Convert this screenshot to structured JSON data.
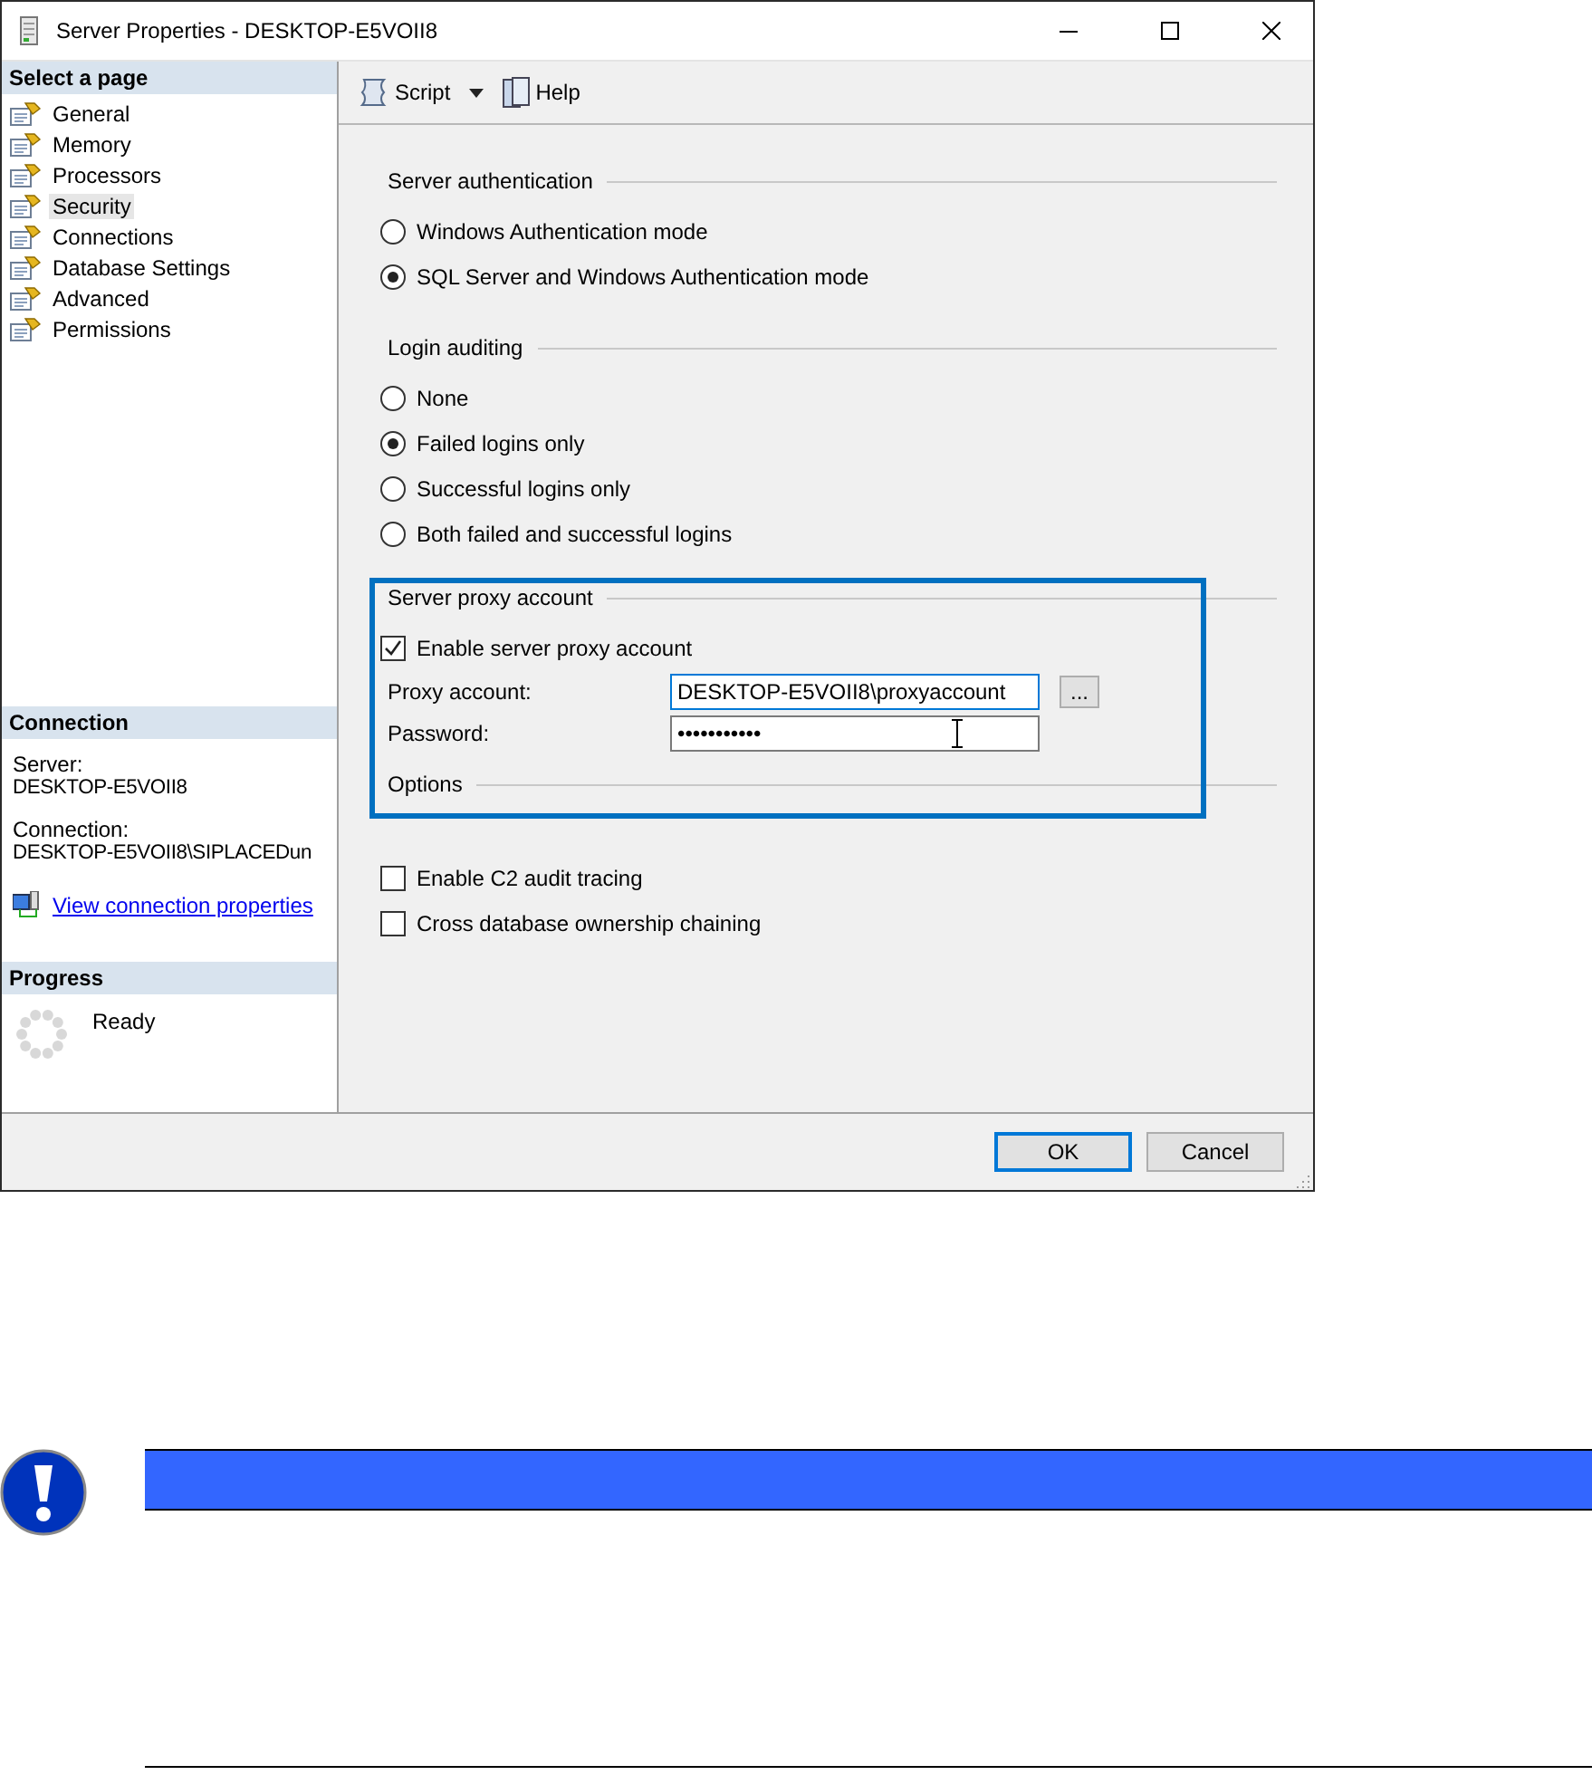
{
  "window": {
    "title": "Server Properties - DESKTOP-E5VOII8"
  },
  "sidebar": {
    "select_page": {
      "title": "Select a page",
      "pages": [
        {
          "label": "General",
          "selected": false
        },
        {
          "label": "Memory",
          "selected": false
        },
        {
          "label": "Processors",
          "selected": false
        },
        {
          "label": "Security",
          "selected": true
        },
        {
          "label": "Connections",
          "selected": false
        },
        {
          "label": "Database Settings",
          "selected": false
        },
        {
          "label": "Advanced",
          "selected": false
        },
        {
          "label": "Permissions",
          "selected": false
        }
      ]
    },
    "connection": {
      "title": "Connection",
      "fields": [
        {
          "label": "Server:",
          "value": "DESKTOP-E5VOII8"
        },
        {
          "label": "Connection:",
          "value": "DESKTOP-E5VOII8\\SIPLACEDun"
        }
      ],
      "link": "View connection properties"
    },
    "progress": {
      "title": "Progress",
      "status": "Ready"
    }
  },
  "toolbar": {
    "script": "Script",
    "help": "Help"
  },
  "sections": [
    {
      "title": "Server authentication",
      "items": [
        {
          "kind": "radio",
          "label": "Windows Authentication mode",
          "selected": false
        },
        {
          "kind": "radio",
          "label": "SQL Server and Windows Authentication mode",
          "selected": true
        }
      ]
    },
    {
      "title": "Login auditing",
      "items": [
        {
          "kind": "radio",
          "label": "None",
          "selected": false
        },
        {
          "kind": "radio",
          "label": "Failed logins only",
          "selected": true
        },
        {
          "kind": "radio",
          "label": "Successful logins only",
          "selected": false
        },
        {
          "kind": "radio",
          "label": "Both failed and successful logins",
          "selected": false
        }
      ]
    },
    {
      "title": "Server proxy account",
      "items": [
        {
          "kind": "checkbox",
          "label": "Enable server proxy account",
          "checked": true
        },
        {
          "kind": "field",
          "label": "Proxy account:",
          "value": "DESKTOP-E5VOII8\\proxyaccount",
          "browse": "..."
        },
        {
          "kind": "password",
          "label": "Password:",
          "value": "•••••••••••"
        }
      ]
    },
    {
      "title": "Options"
    },
    {
      "items": [
        {
          "kind": "checkbox",
          "label": "Enable C2 audit tracing",
          "checked": false
        },
        {
          "kind": "checkbox",
          "label": "Cross database ownership chaining",
          "checked": false
        }
      ]
    }
  ],
  "buttons": [
    {
      "label": "OK",
      "default": true
    },
    {
      "label": "Cancel",
      "default": false
    }
  ]
}
